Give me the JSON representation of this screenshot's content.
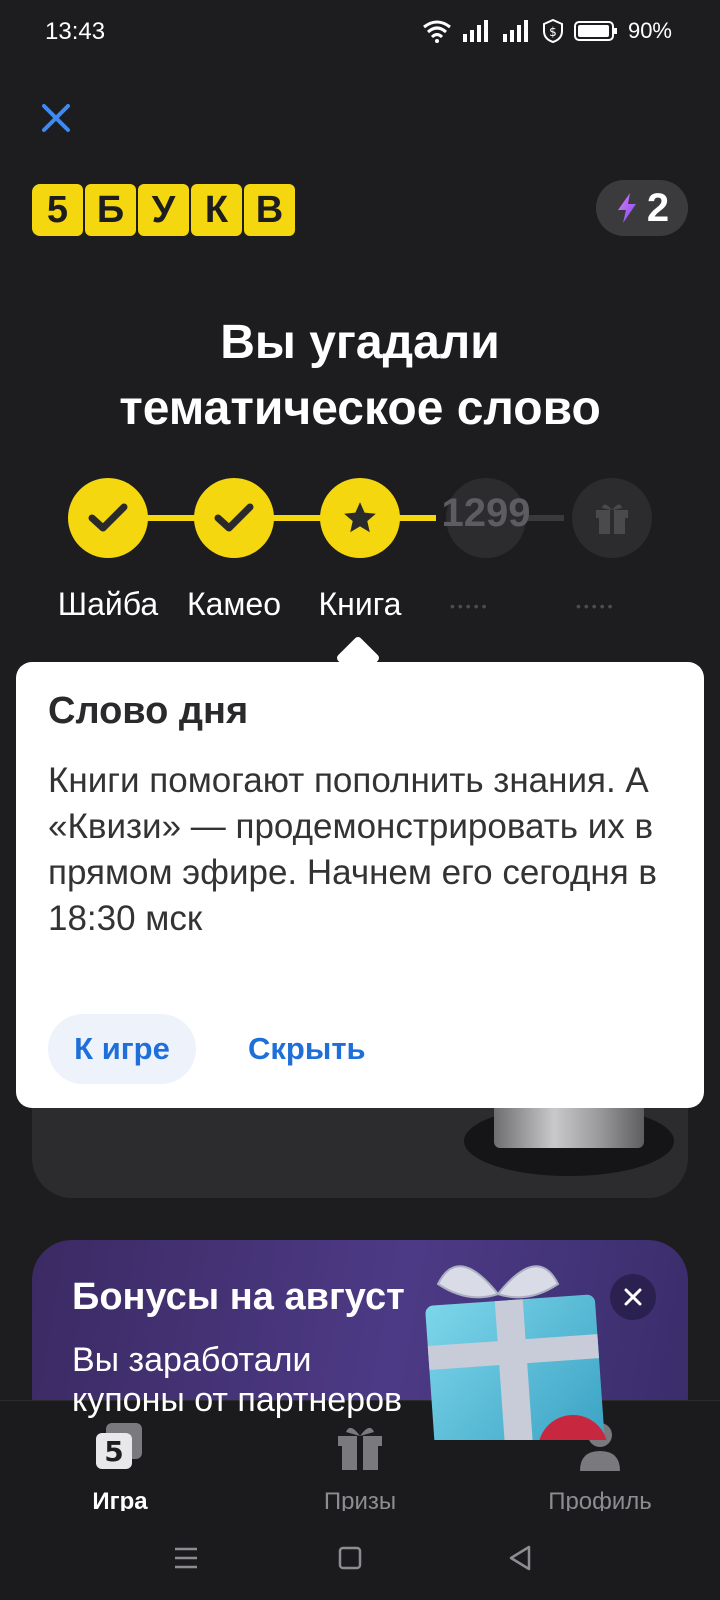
{
  "status_bar": {
    "time": "13:43",
    "battery": "90%"
  },
  "logo": {
    "letters": [
      "5",
      "Б",
      "У",
      "К",
      "В"
    ]
  },
  "energy": {
    "count": "2"
  },
  "title": {
    "line1": "Вы угадали",
    "line2": "тематическое слово"
  },
  "progress": {
    "steps": [
      {
        "label": "Шайба",
        "state": "done"
      },
      {
        "label": "Камео",
        "state": "done"
      },
      {
        "label": "Книга",
        "state": "current"
      },
      {
        "number": "1299",
        "state": "locked"
      },
      {
        "state": "locked-gift"
      }
    ],
    "locked_placeholder": "•••••"
  },
  "popup": {
    "title": "Слово дня",
    "text": "Книги помогают пополнить знания. А «Квизи» — продемонстрировать их в прямом эфире. Начнем его сегодня в 18:30 мск",
    "primary_button": "К игре",
    "secondary_button": "Скрыть"
  },
  "bonus": {
    "title": "Бонусы на август",
    "text_line1": "Вы заработали",
    "text_line2": "купоны от партнеров"
  },
  "bottom_nav": {
    "items": [
      {
        "label": "Игра",
        "active": true
      },
      {
        "label": "Призы",
        "active": false
      },
      {
        "label": "Профиль",
        "active": false
      }
    ]
  },
  "colors": {
    "accent_yellow": "#f5d70f",
    "link_blue": "#1e6fd9",
    "background": "#1d1d1f"
  }
}
